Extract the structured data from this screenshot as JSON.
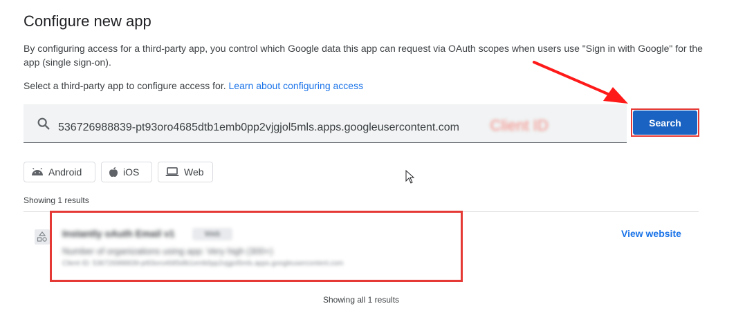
{
  "header": {
    "title": "Configure new app",
    "description": "By configuring access for a third-party app, you control which Google data this app can request via OAuth scopes when users use \"Sign in with Google\" for the app (single sign-on).",
    "select_prompt": "Select a third-party app to configure access for.",
    "learn_link": "Learn about configuring access"
  },
  "search": {
    "value": "536726988839-pt93oro4685dtb1emb0pp2vjgjol5mls.apps.googleusercontent.com",
    "annotation": "Client ID",
    "button_label": "Search"
  },
  "filters": [
    {
      "label": "Android",
      "icon": "android-icon"
    },
    {
      "label": "iOS",
      "icon": "apple-icon"
    },
    {
      "label": "Web",
      "icon": "laptop-icon"
    }
  ],
  "results": {
    "count_text": "Showing 1 results",
    "footer_text": "Showing all 1 results",
    "items": [
      {
        "name": "Instantly oAuth Email v1",
        "tag": "Web",
        "orgs": "Number of organizations using app: Very high (300+)",
        "client_id": "Client ID: 536726988839-pt93oro4685dtb1emb0pp2vjgjol5mls.apps.googleusercontent.com",
        "action": "View website"
      }
    ]
  },
  "colors": {
    "accent": "#1a73e8",
    "button": "#1a63c2",
    "highlight": "#e53935"
  }
}
